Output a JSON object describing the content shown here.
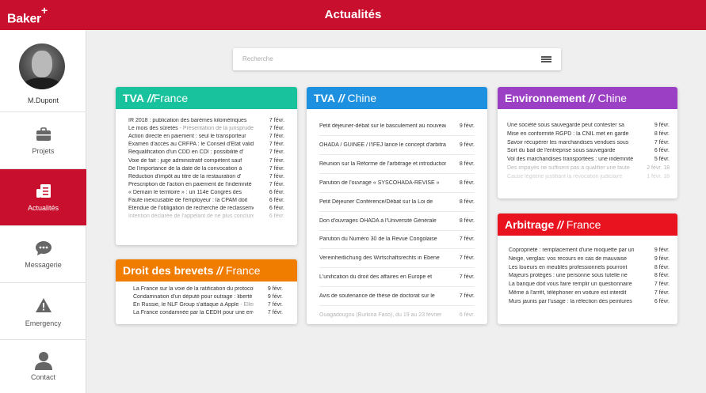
{
  "header": {
    "logo": "Baker",
    "logo_plus": "+",
    "title": "Actualités"
  },
  "user": {
    "name": "M.Dupont"
  },
  "nav": [
    {
      "label": "Projets",
      "icon": "briefcase-icon",
      "active": false
    },
    {
      "label": "Actualités",
      "icon": "news-icon",
      "active": true
    },
    {
      "label": "Messagerie",
      "icon": "chat-icon",
      "active": false
    },
    {
      "label": "Emergency",
      "icon": "warning-icon",
      "active": false
    },
    {
      "label": "Contact",
      "icon": "person-icon",
      "active": false
    }
  ],
  "search": {
    "placeholder": "Recherche"
  },
  "colors": {
    "brand": "#c8102e",
    "tva_fr": "#18c29c",
    "tva_cn": "#1e90e0",
    "env_cn": "#9b3fc4",
    "arb_fr": "#e8131f",
    "brevets_fr": "#f07c00"
  },
  "cards": {
    "tva_fr": {
      "topic": "TVA",
      "sep": " //",
      "region": "France",
      "items": [
        {
          "t": "IR 2018 : publication des barèmes kilométriques",
          "g": "",
          "d": "7 févr."
        },
        {
          "t": "Le mois des sûretés",
          "g": " - Présentation de la jurisprudence",
          "d": "7 févr."
        },
        {
          "t": "Action directe en paiement : seul le transporteur",
          "g": "",
          "d": "7 févr."
        },
        {
          "t": "Examen d'accès au CRFPA : le Conseil d'Etat valide",
          "g": "",
          "d": "7 févr."
        },
        {
          "t": "Requalification d'un CDD en CDI : possibilité d'",
          "g": "",
          "d": "7 févr."
        },
        {
          "t": "Voie de fait : juge administratif compétent sauf",
          "g": "",
          "d": "7 févr."
        },
        {
          "t": "De l'importance de la date de la convocation à",
          "g": "",
          "d": "7 févr."
        },
        {
          "t": "Réduction d'impôt au titre de la restauration d'",
          "g": "",
          "d": "7 févr."
        },
        {
          "t": "Prescription de l'action en paiement de l'indemnité",
          "g": "",
          "d": "7 févr."
        },
        {
          "t": "« Demain le territoire » : un 114e Congrès des",
          "g": "",
          "d": "6 févr."
        },
        {
          "t": "Faute inexcusable de l'employeur : la CPAM doit",
          "g": "",
          "d": "6 févr."
        },
        {
          "t": "Étendue de l'obligation de recherche de reclassement",
          "g": "",
          "d": "6 févr."
        },
        {
          "t": "Intention déclarée de l'appelant de ne plus conclure",
          "g": "",
          "d": "6 févr."
        }
      ]
    },
    "tva_cn": {
      "topic": "TVA",
      "sep": " //",
      "region": " Chine",
      "items": [
        {
          "t": "Petit déjeuner-débat sur le basculement au nouveau",
          "d": "9 févr."
        },
        {
          "t": "OHADA / GUINEE / l'IFEJ lance le concept d'arbitrage",
          "d": "9 févr."
        },
        {
          "t": "Réunion sur la Réforme de l'arbitrage et introduction",
          "d": "8 févr."
        },
        {
          "t": "Parution de l'ouvrage « SYSCOHADA-REVISE »",
          "d": "8 févr."
        },
        {
          "t": "Petit Déjeuner Conférence/Débat sur la Loi de",
          "d": "8 févr."
        },
        {
          "t": "Don d'ouvrages OHADA à l'Université Générale",
          "d": "8 févr."
        },
        {
          "t": "Parution du Numéro 30 de la Revue Congolaise",
          "d": "7 févr."
        },
        {
          "t": "Vereinheitlichung des Wirtschaftsrechts in Ebene",
          "d": "7 févr."
        },
        {
          "t": "L'unification du droit des affaires en Europe et",
          "d": "7 févr."
        },
        {
          "t": "Avis de soutenance de thèse de doctorat sur le",
          "d": "7 févr."
        },
        {
          "t": "Ouagadougou (Burkina Faso), du 19 au 23 février",
          "d": "6 févr."
        }
      ]
    },
    "env_cn": {
      "topic": "Environnement",
      "sep": " //",
      "region": " Chine",
      "items": [
        {
          "t": "Une société sous sauvegarde peut contester sa",
          "d": "9 févr."
        },
        {
          "t": "Mise en conformité RGPD : la CNIL met en garde",
          "d": "8 févr."
        },
        {
          "t": "Savoir récupérer les marchandises vendues sous",
          "d": "7 févr."
        },
        {
          "t": "Sort du bail de l'entreprise sous sauvegarde",
          "d": "6 févr."
        },
        {
          "t": "Vol des marchandises transportées : une indemnité",
          "d": "5 févr."
        },
        {
          "t": "Des impayés ne suffisent pas à qualifier une faute",
          "d": "2 févr. 18"
        },
        {
          "t": "Cause légitime justifiant la révocation judiciaire",
          "d": "1 févr. 18"
        }
      ]
    },
    "arb_fr": {
      "topic": "Arbitrage",
      "sep": " //",
      "region": " France",
      "items": [
        {
          "t": "Copropriété : remplacement d'une moquette par un",
          "d": "9 févr."
        },
        {
          "t": "Neige, verglas: vos recours en cas de mauvaise",
          "d": "9 févr."
        },
        {
          "t": "Les loueurs en meublés professionnels pourront",
          "d": "8 févr."
        },
        {
          "t": "Majeurs protégés : une personne sous tutelle ne",
          "d": "8 févr."
        },
        {
          "t": "La banque doit vous faire remplir un questionnaire",
          "d": "7 févr."
        },
        {
          "t": "Même à l'arrêt, téléphoner en voiture est interdit",
          "d": "7 févr."
        },
        {
          "t": "Murs jaunis par l'usage : la réfection des peintures",
          "d": "6 févr."
        }
      ]
    },
    "brevets_fr": {
      "topic": "Droit des brevets",
      "sep": " //",
      "region": " France",
      "items": [
        {
          "t": "La France sur la voie de la ratification du protocole",
          "g": "",
          "d": "9 févr."
        },
        {
          "t": "Condamnation d'un député pour outrage : liberté",
          "g": "",
          "d": "9 févr."
        },
        {
          "t": "En Russie, le NLF Group s'attaque à Apple",
          "g": " - Ellen",
          "d": "7 févr."
        },
        {
          "t": "La France condamnée par la CEDH pour une erreur",
          "g": "",
          "d": "7 févr."
        }
      ]
    }
  }
}
